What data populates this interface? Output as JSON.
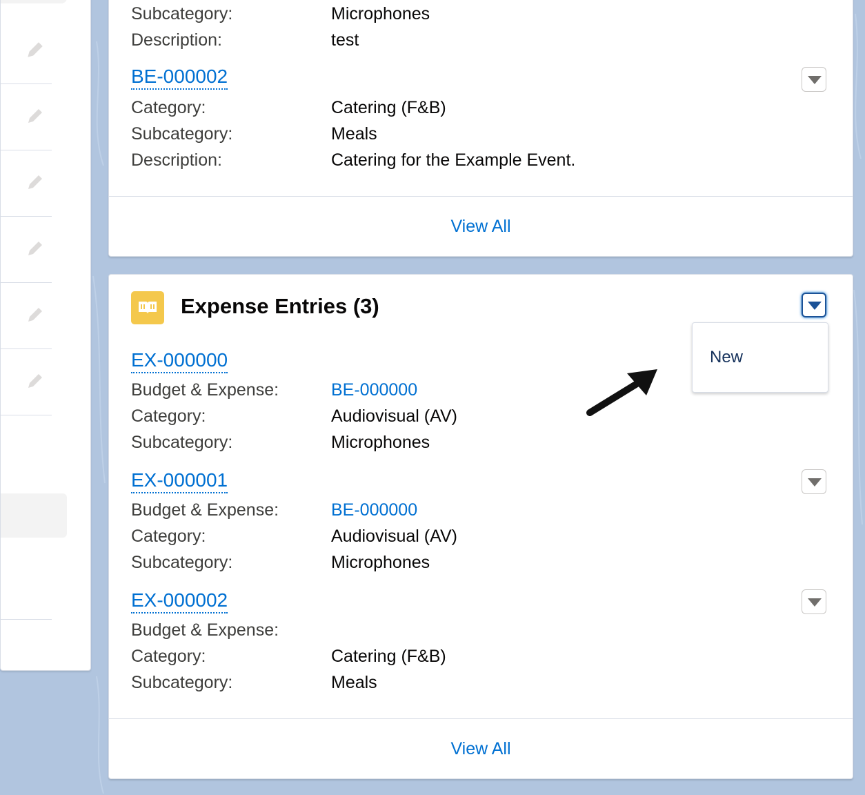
{
  "top_card": {
    "partial_rows": [
      {
        "label": "Subcategory:",
        "value": "Microphones"
      },
      {
        "label": "Description:",
        "value": "test"
      }
    ],
    "record": {
      "id": "BE-000002",
      "rows": [
        {
          "label": "Category:",
          "value": "Catering (F&B)"
        },
        {
          "label": "Subcategory:",
          "value": "Meals"
        },
        {
          "label": "Description:",
          "value": "Catering for the Example Event."
        }
      ]
    },
    "view_all": "View All"
  },
  "expense_card": {
    "title": "Expense Entries (3)",
    "icon": "book-icon",
    "menu": {
      "items": [
        "New"
      ]
    },
    "records": [
      {
        "id": "EX-000000",
        "rows": [
          {
            "label": "Budget & Expense:",
            "value": "BE-000000",
            "link": true
          },
          {
            "label": "Category:",
            "value": "Audiovisual (AV)"
          },
          {
            "label": "Subcategory:",
            "value": "Microphones"
          }
        ]
      },
      {
        "id": "EX-000001",
        "rows": [
          {
            "label": "Budget & Expense:",
            "value": "BE-000000",
            "link": true
          },
          {
            "label": "Category:",
            "value": "Audiovisual (AV)"
          },
          {
            "label": "Subcategory:",
            "value": "Microphones"
          }
        ]
      },
      {
        "id": "EX-000002",
        "rows": [
          {
            "label": "Budget & Expense:",
            "value": ""
          },
          {
            "label": "Category:",
            "value": "Catering (F&B)"
          },
          {
            "label": "Subcategory:",
            "value": "Meals"
          }
        ]
      }
    ],
    "view_all": "View All"
  },
  "colors": {
    "link": "#0070d2",
    "background": "#b1c5df",
    "icon_bg": "#f4c84c",
    "menu_active": "#1b5297"
  }
}
